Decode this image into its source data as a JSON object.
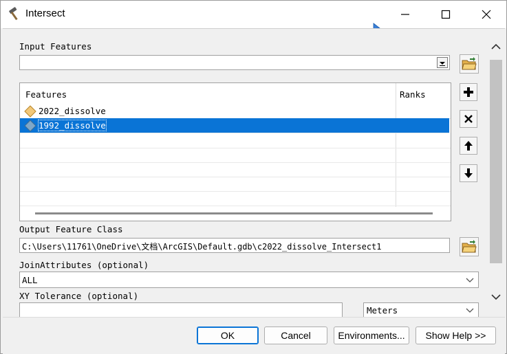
{
  "window": {
    "title": "Intersect"
  },
  "input_features": {
    "label": "Input Features",
    "value": "",
    "headers": [
      "Features",
      "Ranks"
    ],
    "rows": [
      {
        "name": "2022_dissolve",
        "rank": "",
        "selected": false
      },
      {
        "name": "1992_dissolve",
        "rank": "",
        "selected": true
      }
    ]
  },
  "output_feature_class": {
    "label": "Output Feature Class",
    "value": "C:\\Users\\11761\\OneDrive\\文档\\ArcGIS\\Default.gdb\\c2022_dissolve_Intersect1"
  },
  "join_attributes": {
    "label": "JoinAttributes (optional)",
    "value": "ALL"
  },
  "xy_tolerance": {
    "label": "XY Tolerance (optional)",
    "value": "",
    "unit": "Meters"
  },
  "buttons": {
    "ok": "OK",
    "cancel": "Cancel",
    "environments": "Environments...",
    "show_help": "Show Help >>"
  },
  "colors": {
    "selection": "#0a74d6",
    "row_icon_fill": "#f2c879",
    "row_icon_selected_fill": "#7ea7c8"
  }
}
